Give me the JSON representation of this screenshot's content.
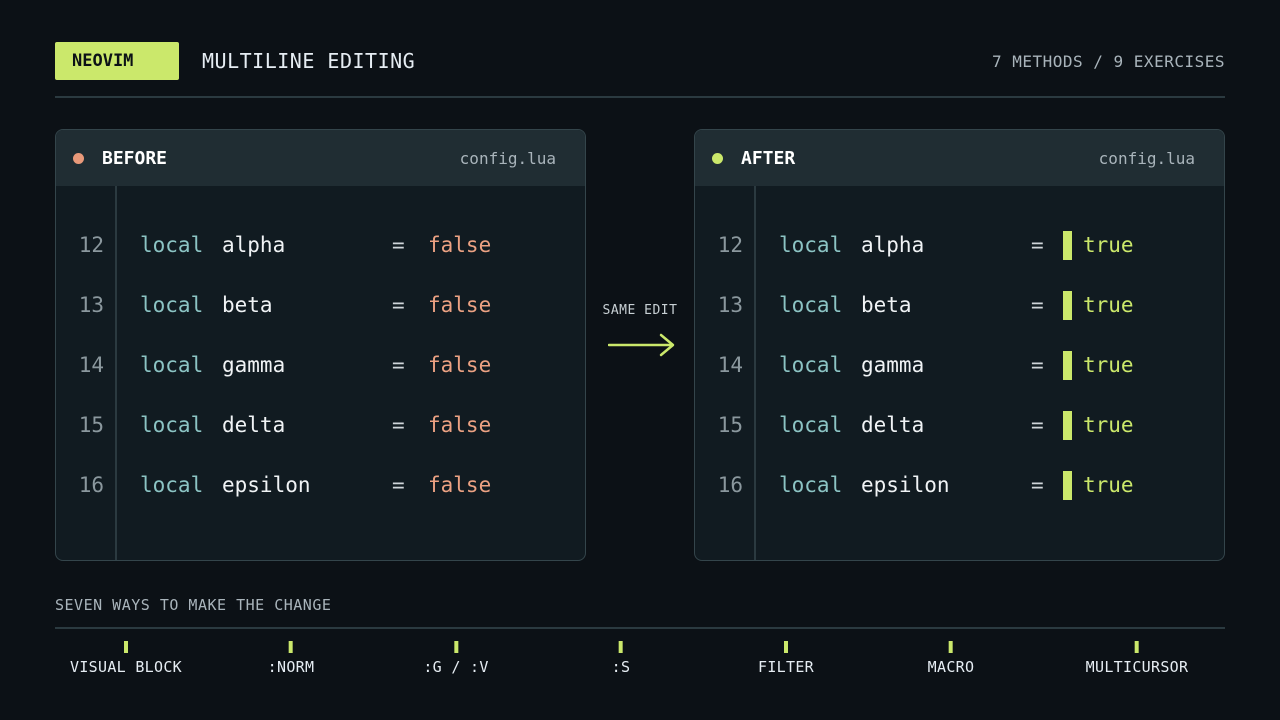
{
  "header": {
    "badge": "NEOVIM",
    "title": "MULTILINE EDITING",
    "counts": "7 METHODS / 9 EXERCISES"
  },
  "before": {
    "title": "BEFORE",
    "file": "config.lua",
    "lines": [
      {
        "num": "12",
        "kw": "local",
        "name": "alpha",
        "eq": "=",
        "value": "false"
      },
      {
        "num": "13",
        "kw": "local",
        "name": "beta",
        "eq": "=",
        "value": "false"
      },
      {
        "num": "14",
        "kw": "local",
        "name": "gamma",
        "eq": "=",
        "value": "false"
      },
      {
        "num": "15",
        "kw": "local",
        "name": "delta",
        "eq": "=",
        "value": "false"
      },
      {
        "num": "16",
        "kw": "local",
        "name": "epsilon",
        "eq": "=",
        "value": "false"
      }
    ]
  },
  "middle": {
    "label": "SAME EDIT"
  },
  "after": {
    "title": "AFTER",
    "file": "config.lua",
    "lines": [
      {
        "num": "12",
        "kw": "local",
        "name": "alpha",
        "eq": "=",
        "value": "true"
      },
      {
        "num": "13",
        "kw": "local",
        "name": "beta",
        "eq": "=",
        "value": "true"
      },
      {
        "num": "14",
        "kw": "local",
        "name": "gamma",
        "eq": "=",
        "value": "true"
      },
      {
        "num": "15",
        "kw": "local",
        "name": "delta",
        "eq": "=",
        "value": "true"
      },
      {
        "num": "16",
        "kw": "local",
        "name": "epsilon",
        "eq": "=",
        "value": "true"
      }
    ]
  },
  "footer": {
    "heading": "SEVEN WAYS TO MAKE THE CHANGE",
    "methods": [
      "VISUAL BLOCK",
      ":NORM",
      ":G / :V",
      ":S",
      "FILTER",
      "MACRO",
      "MULTICURSOR"
    ]
  },
  "colors": {
    "accent": "#cbe86b",
    "before_dot": "#e8997a",
    "false_value": "#eca283",
    "keyword": "#8cc4c4"
  }
}
